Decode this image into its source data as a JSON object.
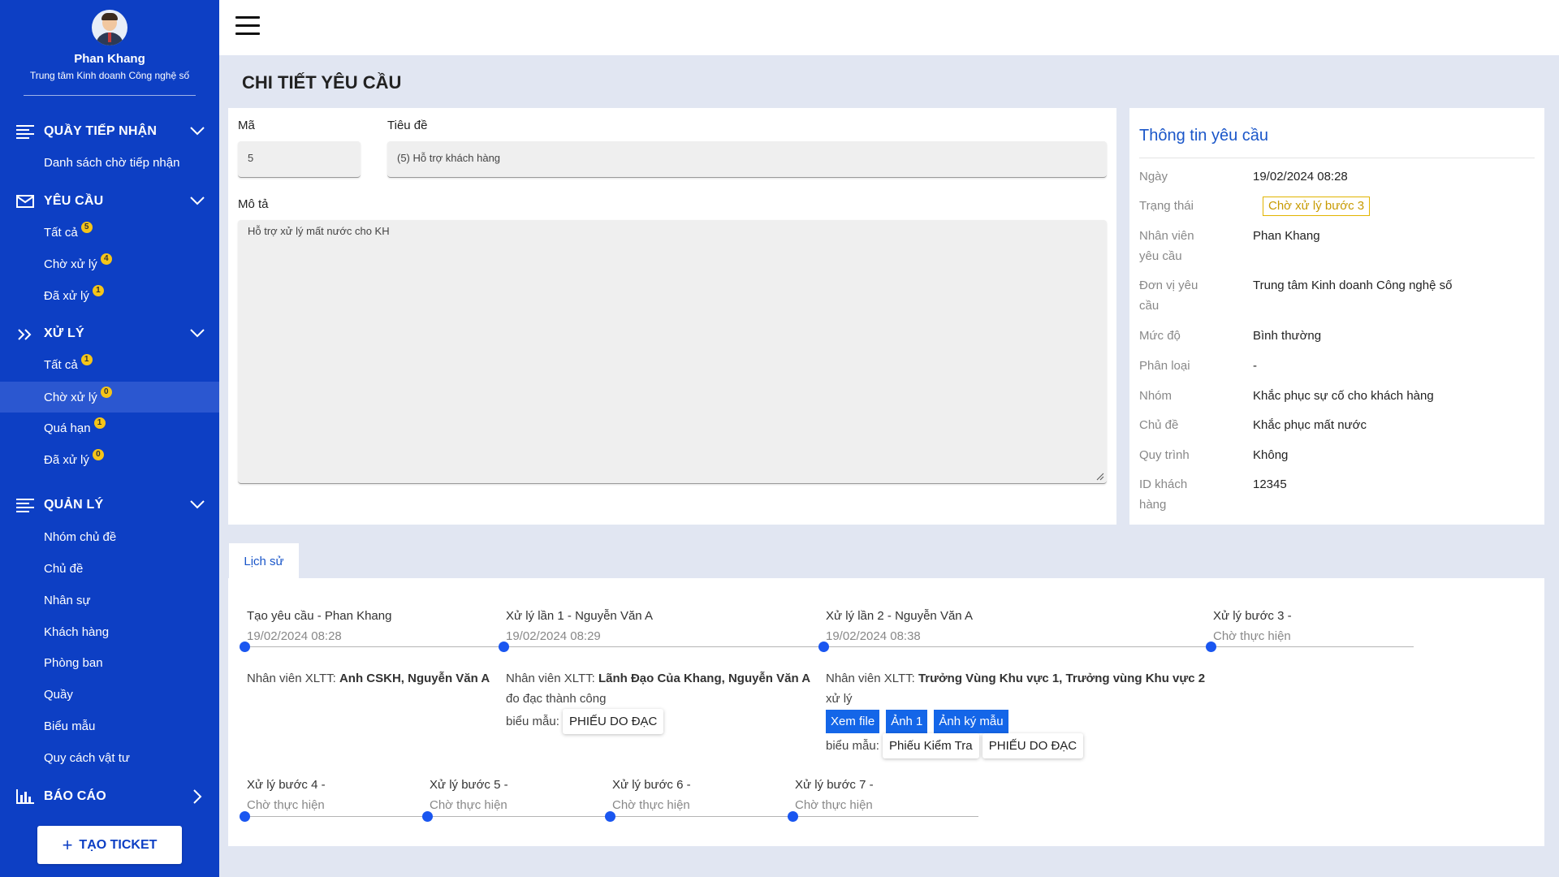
{
  "profile": {
    "name": "Phan Khang",
    "unit": "Trung tâm Kinh doanh Công nghệ số"
  },
  "sidebar": {
    "reception": {
      "title": "QUẦY TIẾP NHẬN",
      "items": [
        {
          "label": "Danh sách chờ tiếp nhận"
        }
      ]
    },
    "requests": {
      "title": "YÊU CẦU",
      "items": [
        {
          "label": "Tất cả",
          "badge": "5"
        },
        {
          "label": "Chờ xử lý",
          "badge": "4"
        },
        {
          "label": "Đã xử lý",
          "badge": "1"
        }
      ]
    },
    "processing": {
      "title": "XỬ LÝ",
      "items": [
        {
          "label": "Tất cả",
          "badge": "1"
        },
        {
          "label": "Chờ xử lý",
          "badge": "0"
        },
        {
          "label": "Quá hạn",
          "badge": "1"
        },
        {
          "label": "Đã xử lý",
          "badge": "0"
        }
      ]
    },
    "management": {
      "title": "QUẢN LÝ",
      "items": [
        {
          "label": "Nhóm chủ đề"
        },
        {
          "label": "Chủ đề"
        },
        {
          "label": "Nhân sự"
        },
        {
          "label": "Khách hàng"
        },
        {
          "label": "Phòng ban"
        },
        {
          "label": "Quầy"
        },
        {
          "label": "Biểu mẫu"
        },
        {
          "label": "Quy cách vật tư"
        }
      ]
    },
    "report": {
      "title": "BÁO CÁO"
    },
    "create_button": "TẠO TICKET"
  },
  "page": {
    "title": "CHI TIẾT YÊU CẦU"
  },
  "form": {
    "code_label": "Mã",
    "code_value": "5",
    "title_label": "Tiêu đề",
    "title_value": "(5) Hỗ trợ khách hàng",
    "desc_label": "Mô tả",
    "desc_value": "Hỗ trợ xử lý mất nước cho KH"
  },
  "info": {
    "title": "Thông tin yêu cầu",
    "rows": [
      {
        "key": "Ngày",
        "value": "19/02/2024 08:28"
      },
      {
        "key": "Trạng thái",
        "value": "Chờ xử lý bước 3"
      },
      {
        "key": "Nhân viên yêu cầu",
        "value": "Phan Khang"
      },
      {
        "key": "Đơn vị yêu cầu",
        "value": "Trung tâm Kinh doanh Công nghệ số"
      },
      {
        "key": "Mức độ",
        "value": "Bình thường"
      },
      {
        "key": "Phân loại",
        "value": "-"
      },
      {
        "key": "Nhóm",
        "value": "Khắc phục sự cố cho khách hàng"
      },
      {
        "key": "Chủ đề",
        "value": "Khắc phục mất nước"
      },
      {
        "key": "Quy trình",
        "value": "Không"
      },
      {
        "key": "ID khách hàng",
        "value": "12345"
      }
    ],
    "status_color": "#e2b400"
  },
  "history": {
    "tab": "Lịch sử",
    "row1": [
      {
        "title": "Tạo yêu cầu - Phan Khang",
        "date": "19/02/2024 08:28",
        "staff_label": "Nhân viên XLTT:",
        "staff": "Anh CSKH, Nguyễn Văn A"
      },
      {
        "title": "Xử lý lần 1 - Nguyễn Văn A",
        "date": "19/02/2024 08:29",
        "staff_label": "Nhân viên XLTT:",
        "staff": "Lãnh Đạo Của Khang, Nguyễn Văn A",
        "note": "đo đạc thành công",
        "form_label": "biểu mẫu:",
        "forms": [
          "PHIẾU DO ĐẠC"
        ]
      },
      {
        "title": "Xử lý lần 2 - Nguyễn Văn A",
        "date": "19/02/2024 08:38",
        "staff_label": "Nhân viên XLTT:",
        "staff": "Trưởng Vùng Khu vực 1, Trưởng vùng Khu vực 2",
        "note": "xử lý",
        "buttons": [
          "Xem file",
          "Ảnh 1",
          "Ảnh ký mẫu"
        ],
        "form_label": "biểu mẫu:",
        "forms": [
          "Phiếu Kiểm Tra",
          "PHIẾU DO ĐẠC"
        ]
      },
      {
        "title": "Xử lý bước 3 -",
        "date": "Chờ thực hiện"
      }
    ],
    "row2": [
      {
        "title": "Xử lý bước 4 -",
        "date": "Chờ thực hiện"
      },
      {
        "title": "Xử lý bước 5 -",
        "date": "Chờ thực hiện"
      },
      {
        "title": "Xử lý bước 6 -",
        "date": "Chờ thực hiện"
      },
      {
        "title": "Xử lý bước 7 -",
        "date": "Chờ thực hiện"
      }
    ],
    "accent": "#1a56f0"
  }
}
